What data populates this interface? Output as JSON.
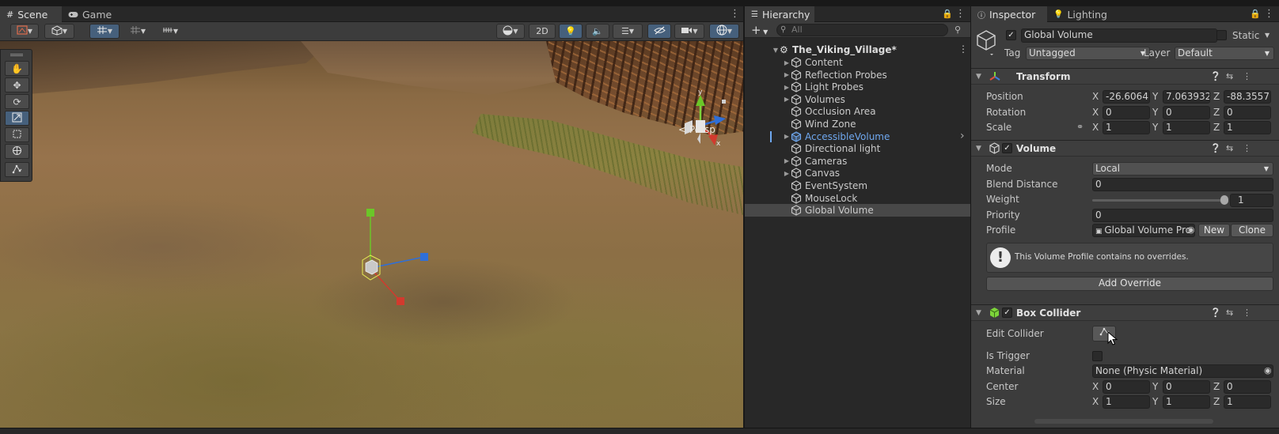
{
  "scene": {
    "tabs": [
      {
        "label": "Scene"
      },
      {
        "label": "Game"
      }
    ],
    "toolbar": {
      "mode_2d": "2D"
    },
    "persp_label": "< Persp",
    "gizmo_axes": {
      "y": "y",
      "x": "x"
    }
  },
  "hierarchy": {
    "tab": "Hierarchy",
    "add_label": "+",
    "search_placeholder": "All",
    "scene_name": "The_Viking_Village*",
    "items": [
      {
        "label": "Content"
      },
      {
        "label": "Reflection Probes"
      },
      {
        "label": "Light Probes"
      },
      {
        "label": "Volumes"
      },
      {
        "label": "Occlusion Area"
      },
      {
        "label": "Wind Zone"
      },
      {
        "label": "AccessibleVolume"
      },
      {
        "label": "Directional light"
      },
      {
        "label": "Cameras"
      },
      {
        "label": "Canvas"
      },
      {
        "label": "EventSystem"
      },
      {
        "label": "MouseLock"
      },
      {
        "label": "Global Volume"
      }
    ]
  },
  "inspector": {
    "tabs": [
      {
        "label": "Inspector"
      },
      {
        "label": "Lighting"
      }
    ],
    "object_name": "Global Volume",
    "static_label": "Static",
    "tag_label": "Tag",
    "tag_value": "Untagged",
    "layer_label": "Layer",
    "layer_value": "Default",
    "transform": {
      "title": "Transform",
      "position_label": "Position",
      "rotation_label": "Rotation",
      "scale_label": "Scale",
      "position": {
        "x": "-26.6064",
        "y": "7.063932",
        "z": "-88.3557"
      },
      "rotation": {
        "x": "0",
        "y": "0",
        "z": "0"
      },
      "scale": {
        "x": "1",
        "y": "1",
        "z": "1"
      }
    },
    "volume": {
      "title": "Volume",
      "mode_label": "Mode",
      "mode_value": "Local",
      "blend_label": "Blend Distance",
      "blend_value": "0",
      "weight_label": "Weight",
      "weight_value": "1",
      "weight_fraction": 1.0,
      "priority_label": "Priority",
      "priority_value": "0",
      "profile_label": "Profile",
      "profile_value": "Global Volume Pro",
      "new_button": "New",
      "clone_button": "Clone",
      "help_text": "This Volume Profile contains no overrides.",
      "add_override": "Add Override"
    },
    "box_collider": {
      "title": "Box Collider",
      "edit_label": "Edit Collider",
      "trigger_label": "Is Trigger",
      "material_label": "Material",
      "material_value": "None (Physic Material)",
      "center_label": "Center",
      "size_label": "Size",
      "center": {
        "x": "0",
        "y": "0",
        "z": "0"
      },
      "size": {
        "x": "1",
        "y": "1",
        "z": "1"
      }
    },
    "axis_labels": {
      "x": "X",
      "y": "Y",
      "z": "Z"
    }
  },
  "colors": {
    "selection_blue": "#46607c",
    "prefab_blue": "#6fa8f0",
    "x_axis": "#d23a2e",
    "y_axis": "#6bc628",
    "z_axis": "#2f6fd8"
  }
}
